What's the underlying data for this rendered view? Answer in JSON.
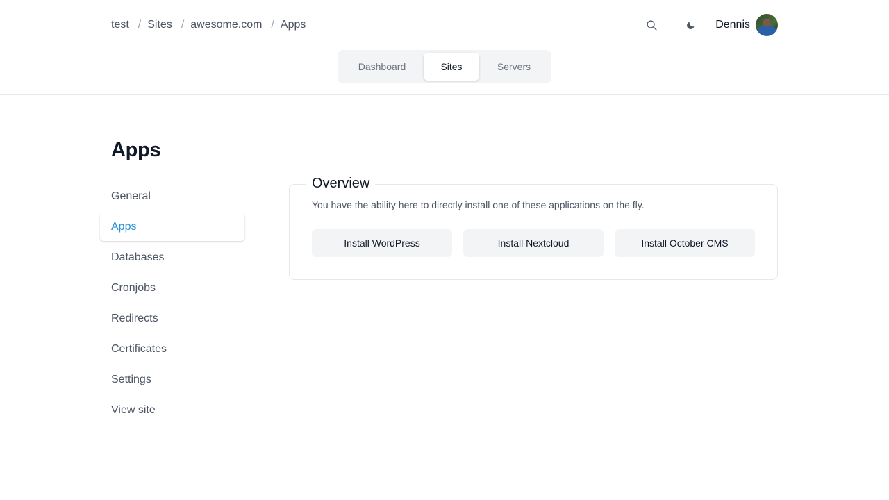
{
  "breadcrumb": {
    "items": [
      {
        "label": "test"
      },
      {
        "label": "Sites"
      },
      {
        "label": "awesome.com"
      },
      {
        "label": "Apps"
      }
    ],
    "separator": "/"
  },
  "header": {
    "search_icon": "search-icon",
    "theme_icon": "moon-icon",
    "user_name": "Dennis"
  },
  "tabs": [
    {
      "label": "Dashboard",
      "active": false
    },
    {
      "label": "Sites",
      "active": true
    },
    {
      "label": "Servers",
      "active": false
    }
  ],
  "page": {
    "title": "Apps"
  },
  "sidebar": {
    "items": [
      {
        "label": "General",
        "active": false
      },
      {
        "label": "Apps",
        "active": true
      },
      {
        "label": "Databases",
        "active": false
      },
      {
        "label": "Cronjobs",
        "active": false
      },
      {
        "label": "Redirects",
        "active": false
      },
      {
        "label": "Certificates",
        "active": false
      },
      {
        "label": "Settings",
        "active": false
      },
      {
        "label": "View site",
        "active": false
      }
    ]
  },
  "overview": {
    "title": "Overview",
    "description": "You have the ability here to directly install one of these applications on the fly.",
    "buttons": [
      {
        "label": "Install WordPress"
      },
      {
        "label": "Install Nextcloud"
      },
      {
        "label": "Install October CMS"
      }
    ]
  },
  "colors": {
    "accent": "#2b8fd9",
    "muted_bg": "#f3f4f6",
    "border": "#e5e7eb"
  }
}
